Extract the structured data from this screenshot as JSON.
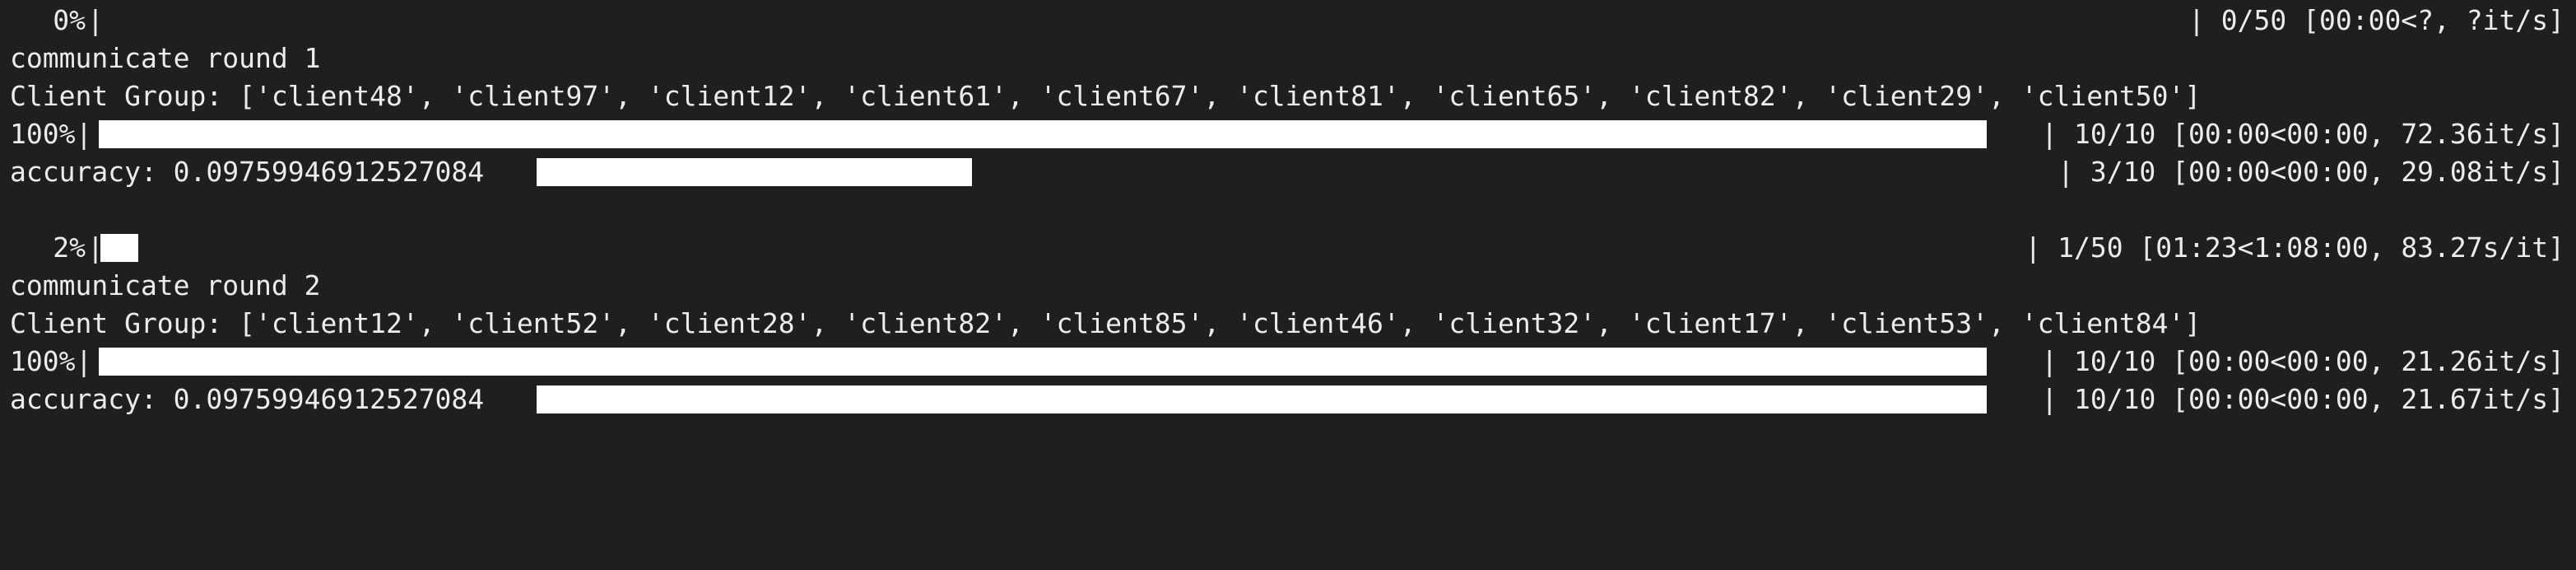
{
  "terminal": {
    "rounds": [
      {
        "overall": {
          "percent": "0%",
          "fill": 0.0,
          "status": "| 0/50 [00:00<?, ?it/s]"
        },
        "round_label": "communicate round 1",
        "client_group": "Client Group: ['client48', 'client97', 'client12', 'client61', 'client67', 'client81', 'client65', 'client82', 'client29', 'client50']",
        "train": {
          "percent": "100%",
          "fill": 1.0,
          "status": "| 10/10 [00:00<00:00, 72.36it/s]"
        },
        "accuracy": {
          "label": "accuracy: 0.09759946912527084",
          "fill": 0.3,
          "status": "| 3/10 [00:00<00:00, 29.08it/s]"
        }
      },
      {
        "overall": {
          "percent": "2%",
          "fill": 0.02,
          "status": "| 1/50 [01:23<1:08:00, 83.27s/it]"
        },
        "round_label": "communicate round 2",
        "client_group": "Client Group: ['client12', 'client52', 'client28', 'client82', 'client85', 'client46', 'client32', 'client17', 'client53', 'client84']",
        "train": {
          "percent": "100%",
          "fill": 1.0,
          "status": "| 10/10 [00:00<00:00, 21.26it/s]"
        },
        "accuracy": {
          "label": "accuracy: 0.09759946912527084",
          "fill": 1.0,
          "status": "| 10/10 [00:00<00:00, 21.67it/s]"
        }
      }
    ]
  }
}
